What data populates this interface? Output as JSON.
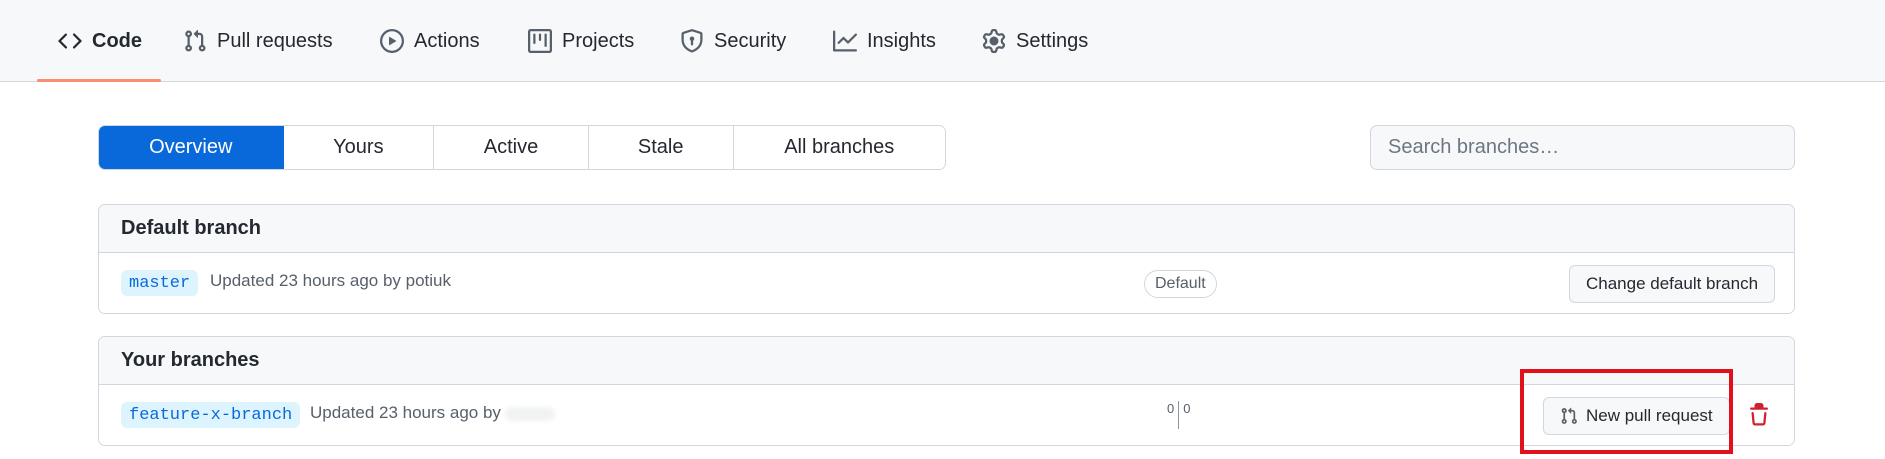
{
  "nav": {
    "items": [
      {
        "label": "Code",
        "icon": "code-icon",
        "selected": true
      },
      {
        "label": "Pull requests",
        "icon": "git-pull-request-icon"
      },
      {
        "label": "Actions",
        "icon": "play-icon"
      },
      {
        "label": "Projects",
        "icon": "table-icon"
      },
      {
        "label": "Security",
        "icon": "shield-icon"
      },
      {
        "label": "Insights",
        "icon": "graph-icon"
      },
      {
        "label": "Settings",
        "icon": "gear-icon"
      }
    ]
  },
  "subnav": {
    "tabs": [
      {
        "label": "Overview",
        "active": true
      },
      {
        "label": "Yours"
      },
      {
        "label": "Active"
      },
      {
        "label": "Stale"
      },
      {
        "label": "All branches"
      }
    ]
  },
  "search": {
    "placeholder": "Search branches…"
  },
  "default_branch": {
    "header": "Default branch",
    "branch": "master",
    "updated": "Updated 23 hours ago by potiuk",
    "label": "Default",
    "change_button": "Change default branch"
  },
  "your_branches": {
    "header": "Your branches",
    "branch": "feature-x-branch",
    "updated": "Updated 23 hours ago by",
    "behind": "0",
    "ahead": "0",
    "new_pr_button": "New pull request"
  },
  "colors": {
    "accent": "#0969da",
    "nav_underline": "#fd8c73",
    "highlight": "#e0111b",
    "danger": "#cf222e"
  }
}
